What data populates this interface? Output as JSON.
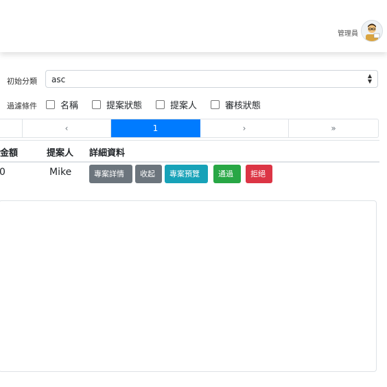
{
  "header": {
    "user_name": "管理員"
  },
  "sort": {
    "label": "初始分類",
    "value": "asc",
    "arrows": "▲▼"
  },
  "filter": {
    "label": "過濾條件",
    "options": [
      {
        "label": "名稱",
        "checked": false
      },
      {
        "label": "提案狀態",
        "checked": false
      },
      {
        "label": "提案人",
        "checked": false
      },
      {
        "label": "審核狀態",
        "checked": false
      }
    ]
  },
  "pagination": {
    "prev": "‹",
    "current": "1",
    "next": "›",
    "last": "»"
  },
  "table": {
    "headers": [
      "資金額",
      "提案人",
      "詳細資料"
    ],
    "rows": [
      {
        "amount": "0",
        "proposer": "Mike"
      }
    ]
  },
  "actions": {
    "details": "專案詳情",
    "collapse": "收起",
    "preview": "專案預覽",
    "approve": "通過",
    "reject": "拒絕"
  },
  "colors": {
    "primary": "#007bff",
    "secondary": "#6c757d",
    "info": "#17a2b8",
    "success": "#28a745",
    "danger": "#dc3545"
  }
}
